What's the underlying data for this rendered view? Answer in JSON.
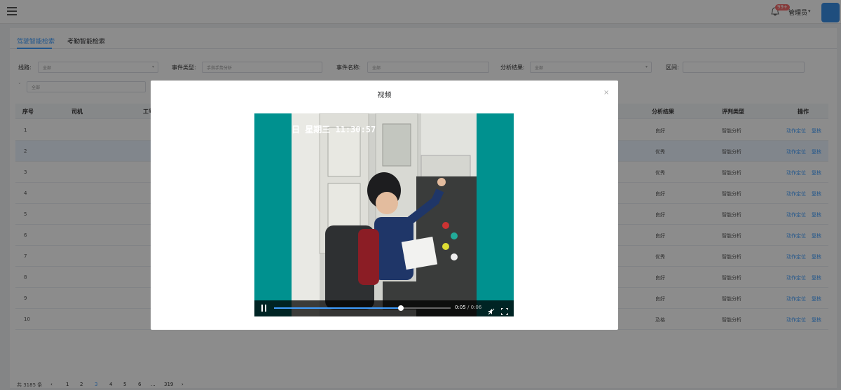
{
  "topbar": {
    "badge": "99+",
    "user": "管理员",
    "caret": "▾"
  },
  "tabs": [
    {
      "label": "驾驶智能检索",
      "active": true
    },
    {
      "label": "考勤智能检索",
      "active": false
    }
  ],
  "filters": {
    "line": {
      "label": "线路:",
      "value": "全部"
    },
    "event_type": {
      "label": "事件类型:",
      "value": "手指手势分析"
    },
    "event_name": {
      "label": "事件名称:",
      "value": "全部"
    },
    "result": {
      "label": "分析结果:",
      "value": "全部"
    },
    "interval": {
      "label": "区间:",
      "value": ""
    },
    "extra_value": "全部"
  },
  "table": {
    "headers": [
      "序号",
      "司机",
      "工号",
      "分析结果",
      "评判类型",
      "操作"
    ],
    "rows": [
      {
        "no": "1",
        "result": "良好",
        "type": "智能分析"
      },
      {
        "no": "2",
        "result": "优秀",
        "type": "智能分析"
      },
      {
        "no": "3",
        "result": "优秀",
        "type": "智能分析"
      },
      {
        "no": "4",
        "result": "良好",
        "type": "智能分析"
      },
      {
        "no": "5",
        "result": "良好",
        "type": "智能分析"
      },
      {
        "no": "6",
        "result": "良好",
        "type": "智能分析"
      },
      {
        "no": "7",
        "result": "优秀",
        "type": "智能分析"
      },
      {
        "no": "8",
        "result": "良好",
        "type": "智能分析"
      },
      {
        "no": "9",
        "result": "良好",
        "type": "智能分析"
      },
      {
        "no": "10",
        "result": "及格",
        "type": "智能分析"
      }
    ],
    "action_locate": "动作定位",
    "action_replay": "复核"
  },
  "pagination": {
    "total": "共 3185 条",
    "prev": "‹",
    "pages": [
      "1",
      "2",
      "3",
      "4",
      "5",
      "6",
      "...",
      "319"
    ],
    "current": "3",
    "next": "›"
  },
  "dialog": {
    "title": "视频",
    "close": "×",
    "osd_text": "日 星期三 11:30:57",
    "time_current": "0:05",
    "time_separator": "/",
    "time_duration": "0:06",
    "progress": 0.72
  },
  "colors": {
    "accent": "#409eff",
    "player_bg": "#00918f"
  }
}
